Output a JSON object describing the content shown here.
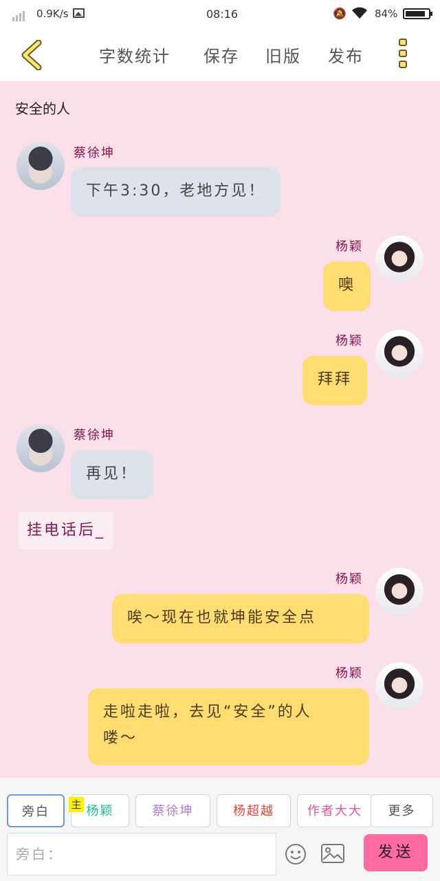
{
  "status_bar": {
    "speed": "0.9K/s",
    "time": "08:16",
    "battery": "84%",
    "battery_level": 0.84,
    "icons": [
      "signal-icon",
      "image-icon",
      "bell-off-icon",
      "wifi-icon",
      "battery-icon"
    ]
  },
  "toolbar": {
    "back_icon": "chevron-left-icon",
    "buttons": [
      "字数统计",
      "保存",
      "旧版",
      "发布"
    ],
    "more_icon": "three-dots-vertical-icon"
  },
  "chat": {
    "title": "安全的人",
    "messages": [
      {
        "speaker": "蔡徐坤",
        "text": "下午3:30，老地方见！"
      },
      {
        "speaker": "杨颖",
        "text": "噢"
      },
      {
        "speaker": "杨颖",
        "text": "拜拜"
      },
      {
        "speaker": "蔡徐坤",
        "text": "再见！"
      },
      {
        "speaker": "",
        "text": "挂电话后_"
      },
      {
        "speaker": "杨颖",
        "text": "唉～现在也就坤能安全点"
      },
      {
        "speaker": "杨颖",
        "text_line1": "走啦走啦，去见“安全”的人",
        "text_line2": "喽～"
      }
    ]
  },
  "bottom": {
    "chips": [
      {
        "label": "旁白",
        "color": "#555555"
      },
      {
        "label": "杨颖",
        "color": "#1bbf9a"
      },
      {
        "label": "蔡徐坤",
        "color": "#b07ad6"
      },
      {
        "label": "杨超越",
        "color": "#e8433a"
      },
      {
        "label": "作者大大",
        "color": "#e9509a"
      },
      {
        "label": "更多",
        "color": "#555555"
      }
    ],
    "main_badge": "主",
    "input_placeholder": "旁白：",
    "send_label": "发送"
  },
  "colors": {
    "background": "#fbdfe9",
    "gray_bubble": "#dde3ec",
    "yellow_bubble": "#ffdd70",
    "name_color": "#8a1550",
    "send_button": "#ff6aa0"
  }
}
